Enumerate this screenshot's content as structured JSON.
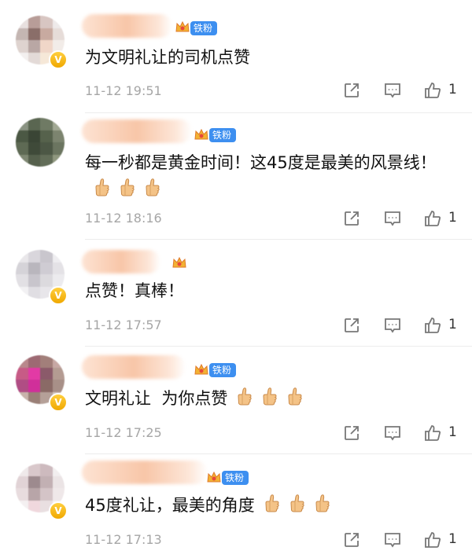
{
  "comments": [
    {
      "username_hidden": true,
      "badge": "铁粉",
      "text": "为文明礼让的司机点赞",
      "thumbs": 0,
      "time": "11-12 19:51",
      "likes": "1"
    },
    {
      "username_hidden": true,
      "badge": "铁粉",
      "text": "每一秒都是黄金时间！这45度是最美的风景线！",
      "thumbs": 3,
      "time": "11-12 18:16",
      "likes": "1"
    },
    {
      "username_hidden": true,
      "badge": "",
      "text": "点赞！真棒！",
      "thumbs": 0,
      "time": "11-12 17:57",
      "likes": "1"
    },
    {
      "username_hidden": true,
      "badge": "铁粉",
      "text": "文明礼让  为你点赞",
      "thumbs": 3,
      "time": "11-12 17:25",
      "likes": "1"
    },
    {
      "username_hidden": true,
      "badge": "铁粉",
      "text": "45度礼让，最美的角度",
      "thumbs": 3,
      "time": "11-12 17:13",
      "likes": "1"
    }
  ],
  "icons": {
    "share": "share-icon",
    "comment": "comment-icon",
    "like": "like-icon",
    "crown": "crown-icon",
    "verified": "verified-icon",
    "thumbs_up": "thumbs-up-emoji"
  },
  "colors": {
    "badge_blue": "#3d8ff0",
    "verified_gold": "#f0a800",
    "meta_gray": "#a6a6a6"
  }
}
